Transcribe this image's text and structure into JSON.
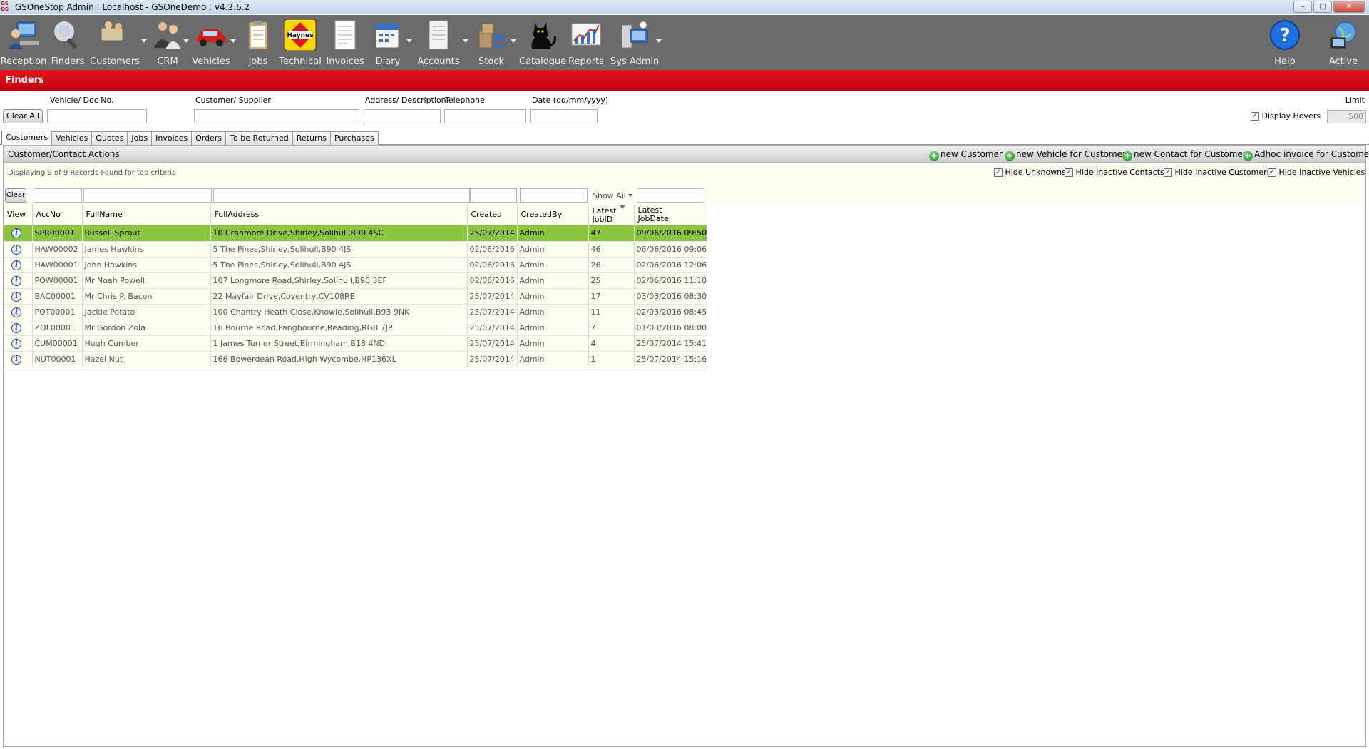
{
  "window": {
    "logo_top": "GS",
    "logo_bottom": "OS",
    "title": "GSOneStop Admin : Localhost - GSOneDemo : v4.2.6.2",
    "minimize": "–",
    "maximize": "□",
    "close": "✕"
  },
  "toolbar": {
    "items": [
      {
        "label": "Reception",
        "icon": "reception-icon"
      },
      {
        "label": "Finders",
        "icon": "magnifier-icon"
      },
      {
        "label": "Customers",
        "icon": "customers-icon"
      },
      {
        "label": "CRM",
        "icon": "crm-icon"
      },
      {
        "label": "Vehicles",
        "icon": "car-icon"
      },
      {
        "label": "Jobs",
        "icon": "clipboard-icon"
      },
      {
        "label": "Technical",
        "icon": "haynes-icon",
        "badge": "Haynes"
      },
      {
        "label": "Invoices",
        "icon": "invoice-icon"
      },
      {
        "label": "Diary",
        "icon": "calendar-icon"
      },
      {
        "label": "Accounts",
        "icon": "accounts-icon"
      },
      {
        "label": "Stock",
        "icon": "stock-icon"
      },
      {
        "label": "Catalogue",
        "icon": "cat-icon"
      },
      {
        "label": "Reports",
        "icon": "chart-icon"
      },
      {
        "label": "Sys Admin",
        "icon": "sysadmin-icon"
      }
    ],
    "help": {
      "label": "Help",
      "glyph": "?"
    },
    "active": {
      "label": "Active"
    }
  },
  "section": {
    "title": "Finders"
  },
  "criteria": {
    "clear_all": "Clear All",
    "vehicle_label": "Vehicle/ Doc No.",
    "customer_label": "Customer/ Supplier",
    "address_label": "Address/ Description",
    "telephone_label": "Telephone",
    "date_label": "Date  (dd/mm/yyyy)",
    "limit_label": "Limit",
    "limit_value": "500",
    "display_hovers": "Display Hovers"
  },
  "tabs": [
    "Customers",
    "Vehicles",
    "Quotes",
    "Jobs",
    "Invoices",
    "Orders",
    "To be Returned",
    "Returns",
    "Purchases"
  ],
  "actions": {
    "title": "Customer/Contact Actions",
    "new_customer": "new Customer",
    "new_vehicle": "new Vehicle for Customer",
    "new_contact": "new Contact for Customer",
    "adhoc_invoice": "Adhoc invoice for Customer"
  },
  "info": {
    "record_count": "Displaying 9 of 9 Records Found for top criteria",
    "hide_unknowns": "Hide Unknowns",
    "hide_inactive_contacts": "Hide Inactive Contacts",
    "hide_inactive_customers": "Hide Inactive Customers",
    "hide_inactive_vehicles": "Hide Inactive Vehicles",
    "clear": "Clear",
    "show_all": "Show All"
  },
  "grid": {
    "headers": {
      "view": "View",
      "accno": "AccNo",
      "fullname": "FullName",
      "fulladdress": "FullAddress",
      "created": "Created",
      "createdby": "CreatedBy",
      "latest_jobid_1": "Latest",
      "latest_jobid_2": "JobID",
      "latest_jobdate_1": "Latest",
      "latest_jobdate_2": "JobDate"
    },
    "rows": [
      {
        "accno": "SPR00001",
        "fullname": "Russell Sprout",
        "address": "10 Cranmore Drive,Shirley,Solihull,B90 4SC",
        "created": "25/07/2014",
        "createdby": "Admin",
        "jobid": "47",
        "jobdate": "09/06/2016 09:50",
        "selected": true
      },
      {
        "accno": "HAW00002",
        "fullname": "James Hawkins",
        "address": "5 The Pines,Shirley,Solihull,B90 4JS",
        "created": "02/06/2016",
        "createdby": "Admin",
        "jobid": "46",
        "jobdate": "06/06/2016 09:06"
      },
      {
        "accno": "HAW00001",
        "fullname": "John Hawkins",
        "address": "5 The Pines,Shirley,Solihull,B90 4JS",
        "created": "02/06/2016",
        "createdby": "Admin",
        "jobid": "26",
        "jobdate": "02/06/2016 12:06"
      },
      {
        "accno": "POW00001",
        "fullname": "Mr Noah Powell",
        "address": "107 Longmore Road,Shirley,Solihull,B90 3EF",
        "created": "02/06/2016",
        "createdby": "Admin",
        "jobid": "25",
        "jobdate": "02/06/2016 11:10"
      },
      {
        "accno": "BAC00001",
        "fullname": "Mr Chris P. Bacon",
        "address": "22 Mayfair Drive,Coventry,CV108RB",
        "created": "25/07/2014",
        "createdby": "Admin",
        "jobid": "17",
        "jobdate": "03/03/2016 08:30"
      },
      {
        "accno": "POT00001",
        "fullname": "Jackie Potato",
        "address": "100 Chantry Heath Close,Knowle,Solihull,B93 9NK",
        "created": "25/07/2014",
        "createdby": "Admin",
        "jobid": "11",
        "jobdate": "02/03/2016 08:45"
      },
      {
        "accno": "ZOL00001",
        "fullname": "Mr Gordon Zola",
        "address": "16 Bourne Road,Pangbourne,Reading,RG8 7JP",
        "created": "25/07/2014",
        "createdby": "Admin",
        "jobid": "7",
        "jobdate": "01/03/2016 08:00"
      },
      {
        "accno": "CUM00001",
        "fullname": "Hugh Cumber",
        "address": "1 James Turner Street,Birmingham,B18 4ND",
        "created": "25/07/2014",
        "createdby": "Admin",
        "jobid": "4",
        "jobdate": "25/07/2014 15:41"
      },
      {
        "accno": "NUT00001",
        "fullname": "Hazel Nut",
        "address": "166 Bowerdean Road,High Wycombe,HP136XL",
        "created": "25/07/2014",
        "createdby": "Admin",
        "jobid": "1",
        "jobdate": "25/07/2014 15:16"
      }
    ]
  },
  "colors": {
    "header_red": "#e8141c",
    "toolbar_gray": "#6b6b6b",
    "selected_row": "#8cc63e",
    "row_bg": "#fdfdf0"
  }
}
